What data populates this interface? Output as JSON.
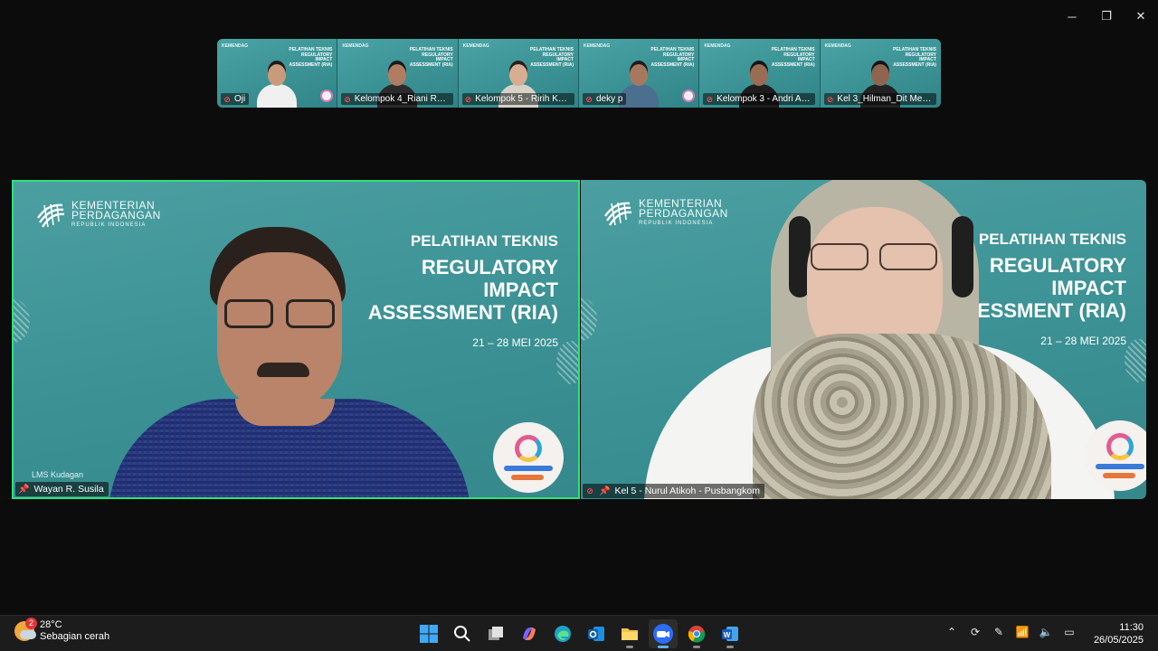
{
  "window": {
    "minimize": "─",
    "restore": "❐",
    "close": "✕"
  },
  "thumbnails": [
    {
      "name": "Oji",
      "skin": "#c99a7b",
      "shirt": "#f0f0f0",
      "hair": "#1e1a18",
      "badge": true
    },
    {
      "name": "Kelompok 4_Riani Resi...",
      "skin": "#b07d62",
      "shirt": "#2b2b2b",
      "hair": "#1a1a1a",
      "badge": false
    },
    {
      "name": "Kelompok 5 - Ririh Kus...",
      "skin": "#d8ae93",
      "shirt": "#d7d2c8",
      "hair": "#2a1f1c",
      "badge": false
    },
    {
      "name": "deky p",
      "skin": "#a8785e",
      "shirt": "#4a6f8f",
      "hair": "#1d1d1d",
      "badge": true
    },
    {
      "name": "Kelompok 3 - Andri Ak...",
      "skin": "#9a6c54",
      "shirt": "#1d1d1d",
      "hair": "#141414",
      "badge": false
    },
    {
      "name": "Kel 3_Hilman_Dit Metr...",
      "skin": "#8f6550",
      "shirt": "#222",
      "hair": "#121212",
      "badge": false
    }
  ],
  "thumb_slide": {
    "logo": "KEMENDAG",
    "title": "PELATIHAN TEKNIS REGULATORY IMPACT ASSESSMENT (RIA)"
  },
  "slide": {
    "brand_line1": "KEMENTERIAN",
    "brand_line2": "PERDAGANGAN",
    "brand_line3": "REPUBLIK INDONESIA",
    "title1": "PELATIHAN TEKNIS",
    "title2": "REGULATORY",
    "title3": "IMPACT",
    "title4": "ASSESSMENT (RIA)",
    "date": "21 – 28 MEI 2025",
    "lms": "LMS Kudagan"
  },
  "participants": {
    "left": "Wayan R. Susila",
    "right": "Kel 5 - Nurul Atikoh - Pusbangkom"
  },
  "taskbar": {
    "weather_badge": "2",
    "temperature": "28°C",
    "condition": "Sebagian cerah",
    "time": "11:30",
    "date": "26/05/2025"
  },
  "colors": {
    "active_speaker": "#2fe07a",
    "slide_teal": "#3b9194"
  }
}
